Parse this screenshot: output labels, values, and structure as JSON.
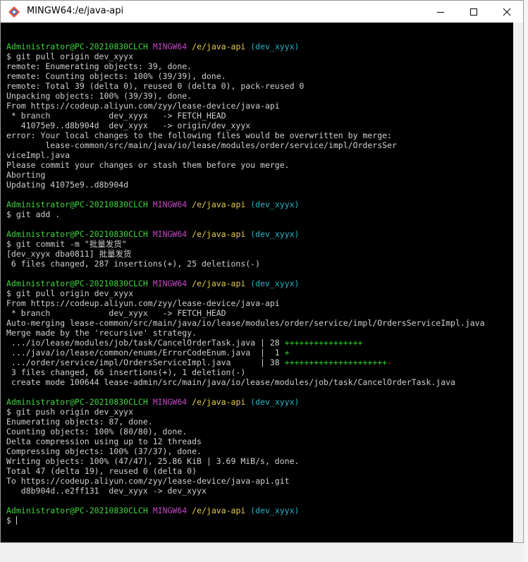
{
  "window": {
    "title": "MINGW64:/e/java-api",
    "minimize_icon": "minimize-icon",
    "maximize_icon": "maximize-icon",
    "close_icon": "close-icon"
  },
  "colors": {
    "terminal_bg": "#000000",
    "text": "#d0d0d0",
    "user": "#3fd63f",
    "system": "#c14ac1",
    "path": "#e6cf4a",
    "branch": "#24b7c9",
    "plus": "#2bd12b",
    "minus": "#d43c3c"
  },
  "prompt": {
    "user_host": "Administrator@PC-20210830CLCH",
    "system": "MINGW64",
    "path": "/e/java-api",
    "branch": "(dev_xyyx)"
  },
  "lines": [
    {
      "type": "blank"
    },
    {
      "type": "prompt"
    },
    {
      "type": "text",
      "text": "$ git pull origin dev_xyyx"
    },
    {
      "type": "text",
      "text": "remote: Enumerating objects: 39, done."
    },
    {
      "type": "text",
      "text": "remote: Counting objects: 100% (39/39), done."
    },
    {
      "type": "text",
      "text": "remote: Total 39 (delta 0), reused 0 (delta 0), pack-reused 0"
    },
    {
      "type": "text",
      "text": "Unpacking objects: 100% (39/39), done."
    },
    {
      "type": "text",
      "text": "From https://codeup.aliyun.com/zyy/lease-device/java-api"
    },
    {
      "type": "text",
      "text": " * branch            dev_xyyx   -> FETCH_HEAD"
    },
    {
      "type": "text",
      "text": "   41075e9..d8b904d  dev_xyyx   -> origin/dev_xyyx"
    },
    {
      "type": "text",
      "text": "error: Your local changes to the following files would be overwritten by merge:"
    },
    {
      "type": "text",
      "text": "        lease-common/src/main/java/io/lease/modules/order/service/impl/OrdersSer"
    },
    {
      "type": "text",
      "text": "viceImpl.java"
    },
    {
      "type": "text",
      "text": "Please commit your changes or stash them before you merge."
    },
    {
      "type": "text",
      "text": "Aborting"
    },
    {
      "type": "text",
      "text": "Updating 41075e9..d8b904d"
    },
    {
      "type": "blank"
    },
    {
      "type": "prompt"
    },
    {
      "type": "text",
      "text": "$ git add ."
    },
    {
      "type": "blank"
    },
    {
      "type": "prompt"
    },
    {
      "type": "text",
      "text": "$ git commit -m \"批量发货\""
    },
    {
      "type": "text",
      "text": "[dev_xyyx dba0811] 批量发货"
    },
    {
      "type": "text",
      "text": " 6 files changed, 287 insertions(+), 25 deletions(-)"
    },
    {
      "type": "blank"
    },
    {
      "type": "prompt"
    },
    {
      "type": "text",
      "text": "$ git pull origin dev_xyyx"
    },
    {
      "type": "text",
      "text": "From https://codeup.aliyun.com/zyy/lease-device/java-api"
    },
    {
      "type": "text",
      "text": " * branch            dev_xyyx   -> FETCH_HEAD"
    },
    {
      "type": "text",
      "text": "Auto-merging lease-common/src/main/java/io/lease/modules/order/service/impl/OrdersServiceImpl.java"
    },
    {
      "type": "text",
      "text": "Merge made by the 'recursive' strategy."
    },
    {
      "type": "diffstat",
      "text": " .../io/lease/modules/job/task/CancelOrderTask.java | 28 ",
      "plus": "++++++++++++++++",
      "minus": ""
    },
    {
      "type": "diffstat",
      "text": " .../java/io/lease/common/enums/ErrorCodeEnum.java  |  1 ",
      "plus": "+",
      "minus": ""
    },
    {
      "type": "diffstat",
      "text": " .../order/service/impl/OrdersServiceImpl.java      | 38 ",
      "plus": "+++++++++++++++++++++",
      "minus": "-"
    },
    {
      "type": "text",
      "text": " 3 files changed, 66 insertions(+), 1 deletion(-)"
    },
    {
      "type": "text",
      "text": " create mode 100644 lease-admin/src/main/java/io/lease/modules/job/task/CancelOrderTask.java"
    },
    {
      "type": "blank"
    },
    {
      "type": "prompt"
    },
    {
      "type": "text",
      "text": "$ git push origin dev_xyyx"
    },
    {
      "type": "text",
      "text": "Enumerating objects: 87, done."
    },
    {
      "type": "text",
      "text": "Counting objects: 100% (80/80), done."
    },
    {
      "type": "text",
      "text": "Delta compression using up to 12 threads"
    },
    {
      "type": "text",
      "text": "Compressing objects: 100% (37/37), done."
    },
    {
      "type": "text",
      "text": "Writing objects: 100% (47/47), 25.86 KiB | 3.69 MiB/s, done."
    },
    {
      "type": "text",
      "text": "Total 47 (delta 19), reused 0 (delta 0)"
    },
    {
      "type": "text",
      "text": "To https://codeup.aliyun.com/zyy/lease-device/java-api.git"
    },
    {
      "type": "text",
      "text": "   d8b904d..e2ff131  dev_xyyx -> dev_xyyx"
    },
    {
      "type": "blank"
    },
    {
      "type": "prompt"
    },
    {
      "type": "cursor",
      "text": "$ "
    }
  ]
}
